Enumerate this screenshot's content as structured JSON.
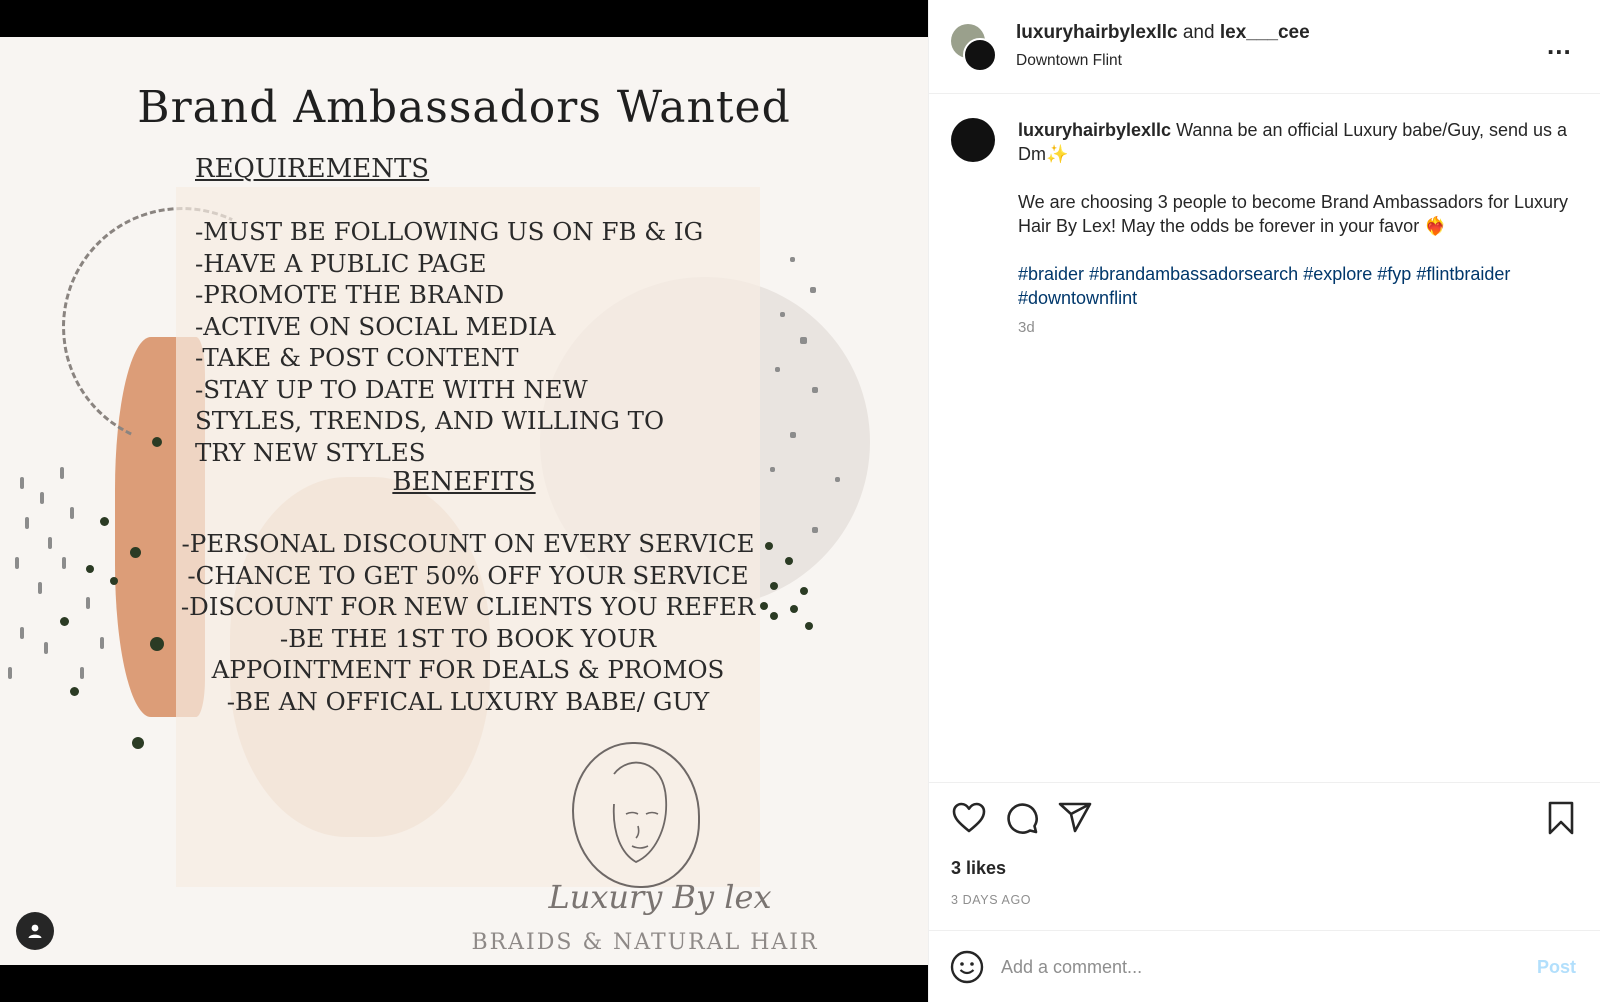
{
  "post_image": {
    "title": "Brand Ambassadors Wanted",
    "requirements_heading": "REQUIREMENTS",
    "requirements": [
      "-MUST BE FOLLOWING US ON FB & IG",
      "-HAVE A PUBLIC PAGE",
      "-PROMOTE THE BRAND",
      "-ACTIVE ON SOCIAL MEDIA",
      "-TAKE & POST CONTENT",
      "-STAY UP TO DATE WITH NEW STYLES, TRENDS, AND WILLING TO TRY NEW STYLES"
    ],
    "benefits_heading": "BENEFITS",
    "benefits": [
      "-PERSONAL DISCOUNT ON EVERY SERVICE",
      "-CHANCE TO GET 50% OFF YOUR SERVICE",
      "-DISCOUNT FOR NEW CLIENTS YOU REFER",
      "-BE THE 1ST TO BOOK YOUR APPOINTMENT FOR DEALS & PROMOS",
      "-BE AN OFFICAL LUXURY BABE/ GUY"
    ],
    "logo_script": "Luxury By lex",
    "logo_subtitle": "BRAIDS & NATURAL HAIR",
    "tag_icon": "user-icon"
  },
  "header": {
    "user1": "luxuryhairbylexllc",
    "connector": "and",
    "user2": "lex___cee",
    "location": "Downtown Flint",
    "more_icon": "more-icon",
    "more_label": "..."
  },
  "caption": {
    "username": "luxuryhairbylexllc",
    "line1": "Wanna be an official Luxury babe/Guy, send us a Dm✨",
    "line2": "We are choosing 3 people to become Brand Ambassadors for Luxury Hair By Lex! May the odds be forever in your favor ❤️‍🔥",
    "hashtags": [
      "#braider",
      "#brandambassadorsearch",
      "#explore",
      "#fyp",
      "#flintbraider",
      "#downtownflint"
    ],
    "time": "3d"
  },
  "actions": {
    "icons": [
      "heart-icon",
      "comment-icon",
      "share-icon",
      "bookmark-icon"
    ],
    "likes": "3 likes",
    "date": "3 DAYS AGO"
  },
  "comment": {
    "placeholder": "Add a comment...",
    "post_label": "Post",
    "emoji_icon": "emoji-icon"
  },
  "colors": {
    "link": "#00376b",
    "post_disabled": "#b2dffc",
    "muted": "#8e8e8e",
    "text": "#262626"
  }
}
